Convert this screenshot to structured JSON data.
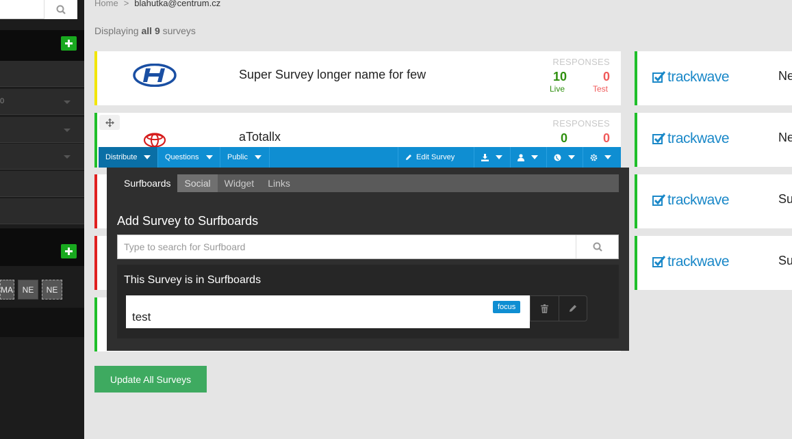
{
  "sidebar": {
    "row_value": "0",
    "tags": [
      "MA",
      "NE",
      "NE"
    ]
  },
  "breadcrumb": {
    "home": "Home",
    "separator": ">",
    "current": "blahutka@centrum.cz"
  },
  "summary": {
    "prefix": "Displaying",
    "bold": "all 9",
    "suffix": "surveys"
  },
  "surveys": [
    {
      "title": "Super Survey longer name for few",
      "responses_label": "RESPONSES",
      "live": "10",
      "test": "0",
      "live_label": "Live",
      "test_label": "Test"
    },
    {
      "title": "aTotallx",
      "responses_label": "RESPONSES",
      "live": "0",
      "test": "0"
    }
  ],
  "toolbar": {
    "distribute": "Distribute",
    "questions": "Questions",
    "public": "Public",
    "edit_survey": "Edit Survey"
  },
  "popup": {
    "tabs": [
      "Surfboards",
      "Social",
      "Widget",
      "Links"
    ],
    "heading": "Add Survey to Surfboards",
    "search_placeholder": "Type to search for Surfboard",
    "subheading": "This Survey is in Surfboards",
    "entry": {
      "name": "test",
      "badge": "focus"
    }
  },
  "update_button": "Update All Surveys",
  "right_cards": [
    {
      "logo": "trackwave",
      "title": "Ne"
    },
    {
      "logo": "trackwave",
      "title": "Ne"
    },
    {
      "logo": "trackwave",
      "title": "Su"
    },
    {
      "logo": "trackwave",
      "title": "Su"
    }
  ],
  "colors": {
    "accent": "#0f8ed2",
    "live": "#2e8f0e",
    "test": "#f05a5a",
    "update": "#3eaa60",
    "add": "#19a91f"
  }
}
